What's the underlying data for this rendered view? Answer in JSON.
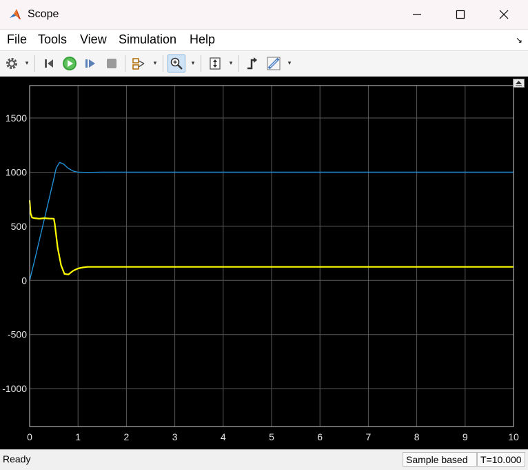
{
  "window": {
    "title": "Scope",
    "icon": "matlab-logo-icon",
    "controls": [
      "minimize-icon",
      "maximize-icon",
      "close-icon"
    ]
  },
  "menu": {
    "items": [
      "File",
      "Tools",
      "View",
      "Simulation",
      "Help"
    ]
  },
  "toolbar": {
    "buttons": [
      "settings-gear-icon",
      "step-back-icon",
      "run-icon",
      "step-forward-icon",
      "stop-icon",
      "highlight-block-icon",
      "zoom-icon",
      "autoscale-icon",
      "trigger-icon",
      "cursor-measure-icon"
    ],
    "active": "zoom-icon"
  },
  "status": {
    "ready": "Ready",
    "mode": "Sample based",
    "time": "T=10.000"
  },
  "colors": {
    "background": "#000000",
    "grid": "#5a5a5a",
    "series1": "#1f8fd6",
    "series2": "#ffff00"
  },
  "chart_data": {
    "type": "line",
    "title": "",
    "xlabel": "",
    "ylabel": "",
    "xlim": [
      0,
      10
    ],
    "ylim": [
      -1350,
      1800
    ],
    "grid": true,
    "x_ticks": [
      "0",
      "1",
      "2",
      "3",
      "4",
      "5",
      "6",
      "7",
      "8",
      "9",
      "10"
    ],
    "y_ticks": [
      "1500",
      "1000",
      "500",
      "0",
      "-500",
      "-1000"
    ],
    "series": [
      {
        "color": "#1f8fd6",
        "x": [
          0,
          0.1,
          0.2,
          0.3,
          0.4,
          0.5,
          0.55,
          0.62,
          0.7,
          0.8,
          0.9,
          1.0,
          1.2,
          1.5,
          2,
          5,
          10
        ],
        "y": [
          0,
          180,
          370,
          560,
          750,
          940,
          1040,
          1090,
          1075,
          1035,
          1010,
          1000,
          998,
          1000,
          1000,
          1000,
          1000
        ]
      },
      {
        "color": "#ffff00",
        "x": [
          0,
          0.02,
          0.05,
          0.1,
          0.2,
          0.3,
          0.4,
          0.5,
          0.52,
          0.58,
          0.65,
          0.72,
          0.8,
          0.9,
          1.0,
          1.1,
          1.2,
          1.4,
          2,
          5,
          10
        ],
        "y": [
          740,
          620,
          580,
          575,
          570,
          575,
          572,
          570,
          520,
          300,
          140,
          60,
          55,
          90,
          110,
          120,
          125,
          125,
          125,
          125,
          125
        ]
      }
    ]
  }
}
